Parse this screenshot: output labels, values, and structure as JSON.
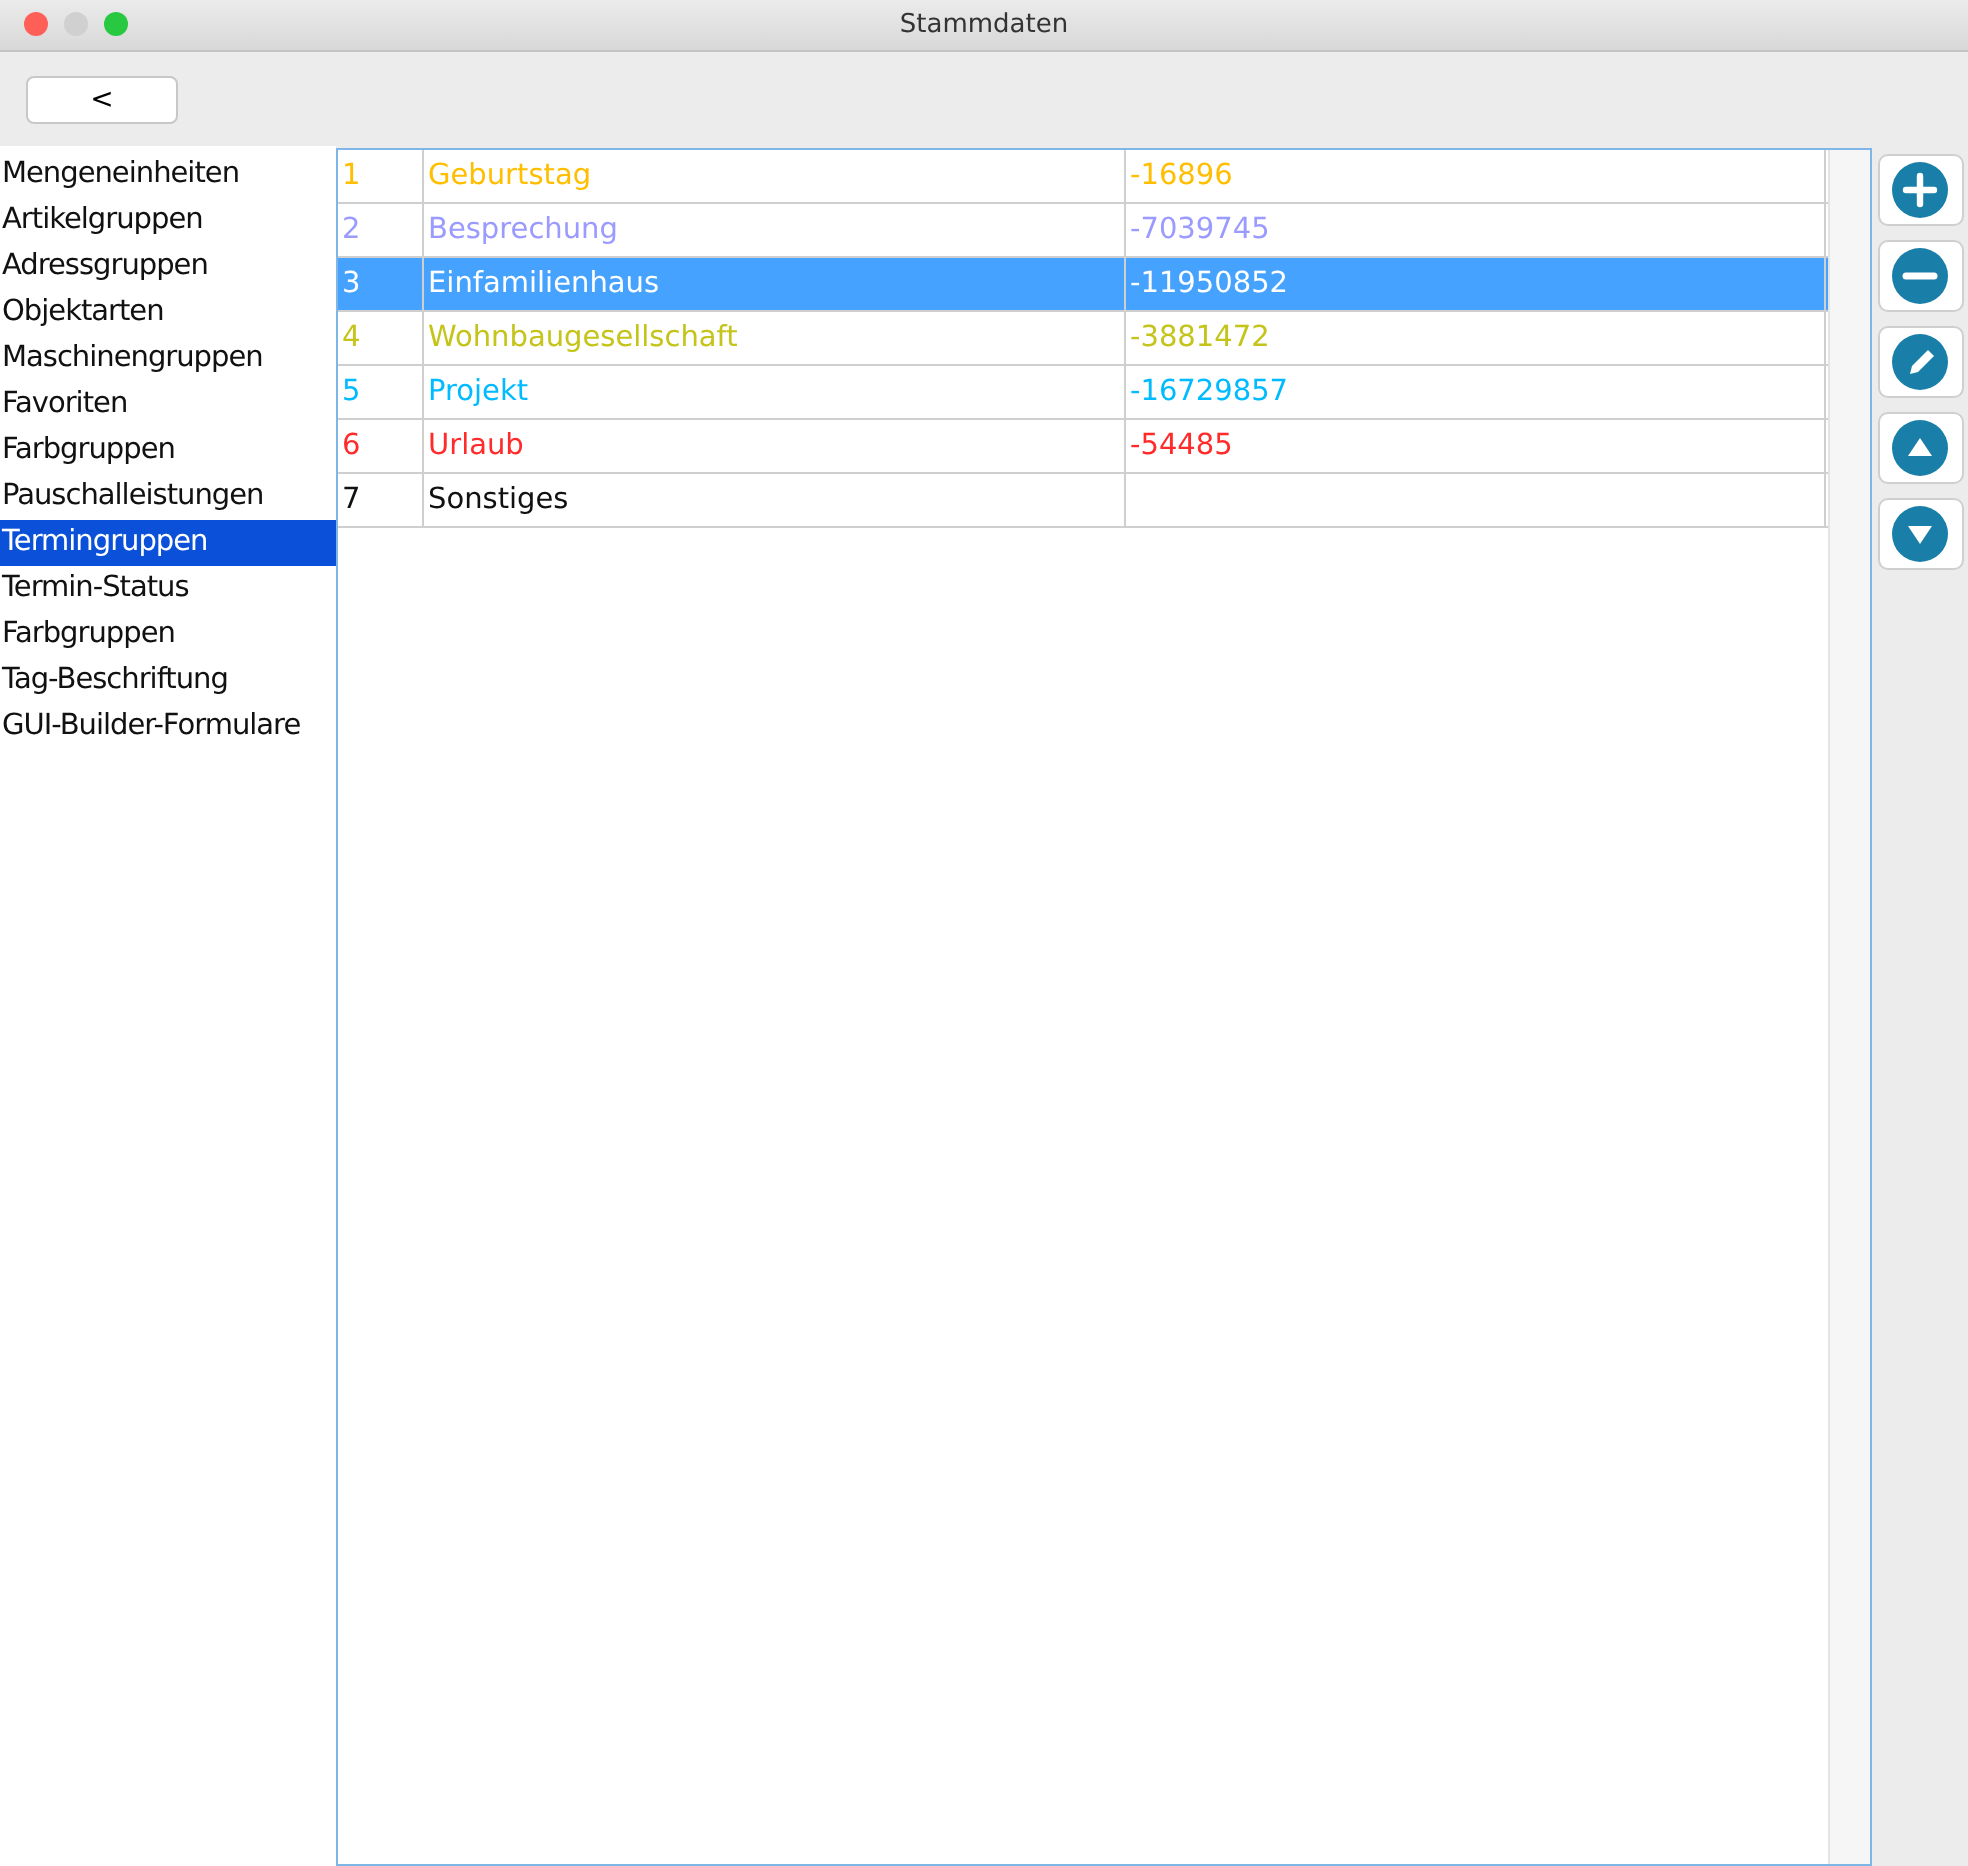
{
  "window": {
    "title": "Stammdaten"
  },
  "back_button": {
    "label": "<"
  },
  "sidebar": {
    "items": [
      {
        "label": "Mengeneinheiten",
        "selected": false
      },
      {
        "label": "Artikelgruppen",
        "selected": false
      },
      {
        "label": "Adressgruppen",
        "selected": false
      },
      {
        "label": "Objektarten",
        "selected": false
      },
      {
        "label": "Maschinengruppen",
        "selected": false
      },
      {
        "label": "Favoriten",
        "selected": false
      },
      {
        "label": "Farbgruppen",
        "selected": false
      },
      {
        "label": "Pauschalleistungen",
        "selected": false
      },
      {
        "label": "Termingruppen",
        "selected": true
      },
      {
        "label": "Termin-Status",
        "selected": false
      },
      {
        "label": "Farbgruppen",
        "selected": false
      },
      {
        "label": "Tag-Beschriftung",
        "selected": false
      },
      {
        "label": "GUI-Builder-Formulare",
        "selected": false
      }
    ]
  },
  "table": {
    "rows": [
      {
        "index": "1",
        "name": "Geburtstag",
        "value": "-16896",
        "color": "#ffbe00",
        "selected": false
      },
      {
        "index": "2",
        "name": "Besprechung",
        "value": "-7039745",
        "color": "#9a9aff",
        "selected": false
      },
      {
        "index": "3",
        "name": "Einfamilienhaus",
        "value": "-11950852",
        "selected": true
      },
      {
        "index": "4",
        "name": "Wohnbaugesellschaft",
        "value": "-3881472",
        "color": "#c4c41a",
        "selected": false
      },
      {
        "index": "5",
        "name": "Projekt",
        "value": "-16729857",
        "color": "#00bbff",
        "selected": false
      },
      {
        "index": "6",
        "name": "Urlaub",
        "value": "-54485",
        "color": "#ff2b2b",
        "selected": false
      },
      {
        "index": "7",
        "name": "Sonstiges",
        "value": "",
        "color": "#111111",
        "selected": false
      }
    ]
  },
  "actions": [
    {
      "kind": "add"
    },
    {
      "kind": "remove"
    },
    {
      "kind": "edit"
    },
    {
      "kind": "up"
    },
    {
      "kind": "down"
    }
  ]
}
